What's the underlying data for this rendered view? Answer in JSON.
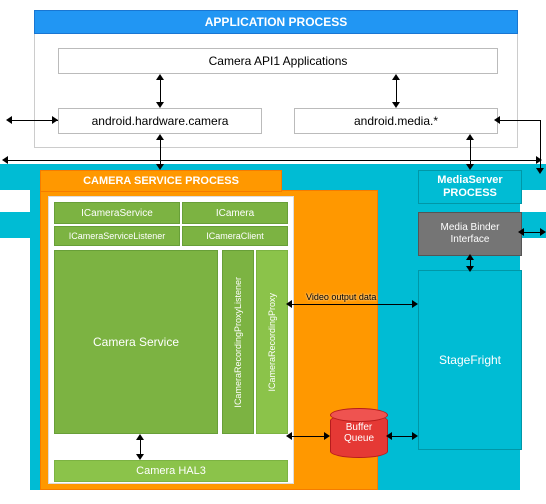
{
  "app_process": {
    "title": "APPLICATION PROCESS",
    "api": "Camera API1 Applications",
    "hw": "android.hardware.camera",
    "media": "android.media.*"
  },
  "camera_service": {
    "title": "CAMERA SERVICE PROCESS",
    "icameraservice": "ICameraService",
    "icamera": "ICamera",
    "icameraservicelistener": "ICameraServiceListener",
    "icameraclient": "ICameraClient",
    "recproxy_listener": "ICameraRecordingProxyListener",
    "recproxy": "ICameraRecordingProxy",
    "service": "Camera Service",
    "hal3": "Camera HAL3"
  },
  "mediaserver": {
    "title": "MediaServer PROCESS",
    "binder": "Media Binder Interface",
    "stagefright": "StageFright",
    "video_label": "Video output data"
  },
  "buffer": "Buffer Queue",
  "colors": {
    "blue_hdr": "#2196f3",
    "cyan": "#00bcd4",
    "orange": "#ff9800",
    "green": "#7cb342",
    "green_light": "#8bc34a",
    "gray": "#757575",
    "red": "#e53935"
  }
}
